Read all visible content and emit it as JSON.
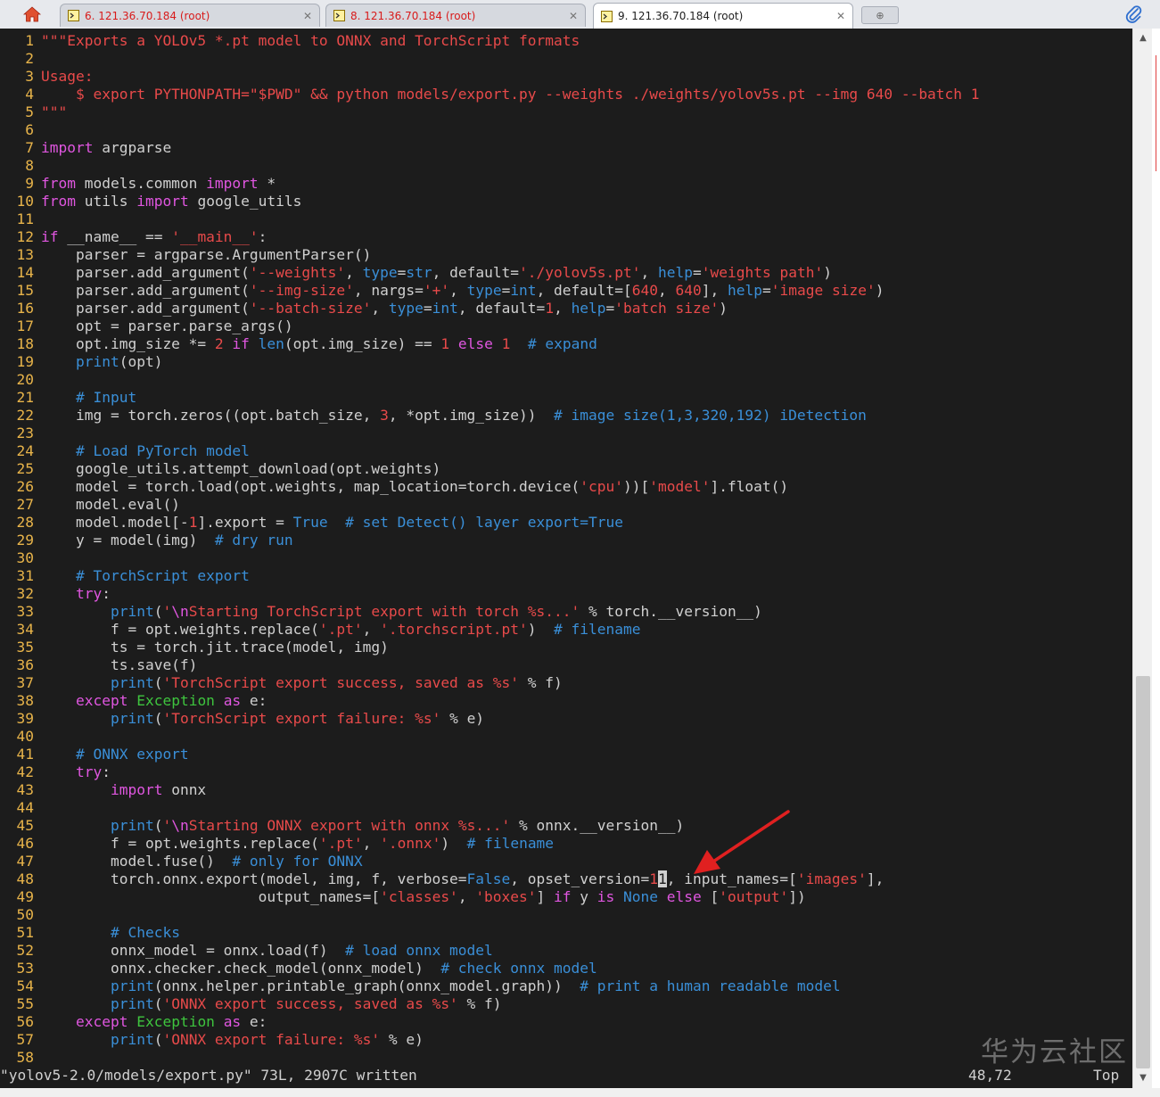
{
  "tabs": [
    {
      "title": "6. 121.36.70.184 (root)",
      "active": false
    },
    {
      "title": "8. 121.36.70.184 (root)",
      "active": false
    },
    {
      "title": "9. 121.36.70.184 (root)",
      "active": true
    }
  ],
  "icons": {
    "home": "home-icon",
    "terminal": "terminal-icon",
    "close": "close-icon",
    "new_tab": "new-tab-icon",
    "attachment": "paperclip-icon"
  },
  "colors": {
    "background": "#1c1c1c",
    "line_number": "#e8b44a",
    "string": "#e84a4a",
    "keyword": "#e056e0",
    "comment": "#3a8fd8",
    "class": "#3ec43e",
    "annotation_arrow": "#e02020"
  },
  "lines": [
    [
      [
        "s",
        "\"\"\"Exports a YOLOv5 *.pt model to ONNX and TorchScript formats"
      ]
    ],
    [],
    [
      [
        "s",
        "Usage:"
      ]
    ],
    [
      [
        "s",
        "    $ export PYTHONPATH=\"$PWD\" && python models/export.py --weights ./weights/yolov5s.pt --img 640 --batch 1"
      ]
    ],
    [
      [
        "s",
        "\"\"\""
      ]
    ],
    [],
    [
      [
        "k",
        "import"
      ],
      [
        "t",
        " argparse"
      ]
    ],
    [],
    [
      [
        "k",
        "from"
      ],
      [
        "t",
        " models.common "
      ],
      [
        "k",
        "import"
      ],
      [
        "t",
        " *"
      ]
    ],
    [
      [
        "k",
        "from"
      ],
      [
        "t",
        " utils "
      ],
      [
        "k",
        "import"
      ],
      [
        "t",
        " google_utils"
      ]
    ],
    [],
    [
      [
        "k",
        "if"
      ],
      [
        "t",
        " __name__ == "
      ],
      [
        "s",
        "'__main__'"
      ],
      [
        "t",
        ":"
      ]
    ],
    [
      [
        "t",
        "    parser = argparse.ArgumentParser()"
      ]
    ],
    [
      [
        "t",
        "    parser.add_argument("
      ],
      [
        "s",
        "'--weights'"
      ],
      [
        "t",
        ", "
      ],
      [
        "b",
        "type"
      ],
      [
        "t",
        "="
      ],
      [
        "b",
        "str"
      ],
      [
        "t",
        ", default="
      ],
      [
        "s",
        "'./yolov5s.pt'"
      ],
      [
        "t",
        ", "
      ],
      [
        "b",
        "help"
      ],
      [
        "t",
        "="
      ],
      [
        "s",
        "'weights path'"
      ],
      [
        "t",
        ")"
      ]
    ],
    [
      [
        "t",
        "    parser.add_argument("
      ],
      [
        "s",
        "'--img-size'"
      ],
      [
        "t",
        ", nargs="
      ],
      [
        "s",
        "'+'"
      ],
      [
        "t",
        ", "
      ],
      [
        "b",
        "type"
      ],
      [
        "t",
        "="
      ],
      [
        "b",
        "int"
      ],
      [
        "t",
        ", default=["
      ],
      [
        "n",
        "640"
      ],
      [
        "t",
        ", "
      ],
      [
        "n",
        "640"
      ],
      [
        "t",
        "], "
      ],
      [
        "b",
        "help"
      ],
      [
        "t",
        "="
      ],
      [
        "s",
        "'image size'"
      ],
      [
        "t",
        ")"
      ]
    ],
    [
      [
        "t",
        "    parser.add_argument("
      ],
      [
        "s",
        "'--batch-size'"
      ],
      [
        "t",
        ", "
      ],
      [
        "b",
        "type"
      ],
      [
        "t",
        "="
      ],
      [
        "b",
        "int"
      ],
      [
        "t",
        ", default="
      ],
      [
        "n",
        "1"
      ],
      [
        "t",
        ", "
      ],
      [
        "b",
        "help"
      ],
      [
        "t",
        "="
      ],
      [
        "s",
        "'batch size'"
      ],
      [
        "t",
        ")"
      ]
    ],
    [
      [
        "t",
        "    opt = parser.parse_args()"
      ]
    ],
    [
      [
        "t",
        "    opt.img_size *= "
      ],
      [
        "n",
        "2"
      ],
      [
        "t",
        " "
      ],
      [
        "k",
        "if"
      ],
      [
        "t",
        " "
      ],
      [
        "b",
        "len"
      ],
      [
        "t",
        "(opt.img_size) == "
      ],
      [
        "n",
        "1"
      ],
      [
        "t",
        " "
      ],
      [
        "k",
        "else"
      ],
      [
        "t",
        " "
      ],
      [
        "n",
        "1"
      ],
      [
        "t",
        "  "
      ],
      [
        "c",
        "# expand"
      ]
    ],
    [
      [
        "t",
        "    "
      ],
      [
        "b",
        "print"
      ],
      [
        "t",
        "(opt)"
      ]
    ],
    [],
    [
      [
        "t",
        "    "
      ],
      [
        "c",
        "# Input"
      ]
    ],
    [
      [
        "t",
        "    img = torch.zeros((opt.batch_size, "
      ],
      [
        "n",
        "3"
      ],
      [
        "t",
        ", *opt.img_size))  "
      ],
      [
        "c",
        "# image size(1,3,320,192) iDetection"
      ]
    ],
    [],
    [
      [
        "t",
        "    "
      ],
      [
        "c",
        "# Load PyTorch model"
      ]
    ],
    [
      [
        "t",
        "    google_utils.attempt_download(opt.weights)"
      ]
    ],
    [
      [
        "t",
        "    model = torch.load(opt.weights, map_location=torch.device("
      ],
      [
        "s",
        "'cpu'"
      ],
      [
        "t",
        "))["
      ],
      [
        "s",
        "'model'"
      ],
      [
        "t",
        "].float()"
      ]
    ],
    [
      [
        "t",
        "    model.eval()"
      ]
    ],
    [
      [
        "t",
        "    model.model[-"
      ],
      [
        "n",
        "1"
      ],
      [
        "t",
        "].export = "
      ],
      [
        "b",
        "True"
      ],
      [
        "t",
        "  "
      ],
      [
        "c",
        "# set Detect() layer export=True"
      ]
    ],
    [
      [
        "t",
        "    y = model(img)  "
      ],
      [
        "c",
        "# dry run"
      ]
    ],
    [],
    [
      [
        "t",
        "    "
      ],
      [
        "c",
        "# TorchScript export"
      ]
    ],
    [
      [
        "t",
        "    "
      ],
      [
        "k",
        "try"
      ],
      [
        "t",
        ":"
      ]
    ],
    [
      [
        "t",
        "        "
      ],
      [
        "b",
        "print"
      ],
      [
        "t",
        "("
      ],
      [
        "s",
        "'"
      ],
      [
        "k",
        "\\n"
      ],
      [
        "s",
        "Starting TorchScript export with torch %s...'"
      ],
      [
        "t",
        " % torch.__version__)"
      ]
    ],
    [
      [
        "t",
        "        f = opt.weights.replace("
      ],
      [
        "s",
        "'.pt'"
      ],
      [
        "t",
        ", "
      ],
      [
        "s",
        "'.torchscript.pt'"
      ],
      [
        "t",
        ")  "
      ],
      [
        "c",
        "# filename"
      ]
    ],
    [
      [
        "t",
        "        ts = torch.jit.trace(model, img)"
      ]
    ],
    [
      [
        "t",
        "        ts.save(f)"
      ]
    ],
    [
      [
        "t",
        "        "
      ],
      [
        "b",
        "print"
      ],
      [
        "t",
        "("
      ],
      [
        "s",
        "'TorchScript export success, saved as %s'"
      ],
      [
        "t",
        " % f)"
      ]
    ],
    [
      [
        "t",
        "    "
      ],
      [
        "k",
        "except"
      ],
      [
        "t",
        " "
      ],
      [
        "g",
        "Exception"
      ],
      [
        "t",
        " "
      ],
      [
        "k",
        "as"
      ],
      [
        "t",
        " e:"
      ]
    ],
    [
      [
        "t",
        "        "
      ],
      [
        "b",
        "print"
      ],
      [
        "t",
        "("
      ],
      [
        "s",
        "'TorchScript export failure: %s'"
      ],
      [
        "t",
        " % e)"
      ]
    ],
    [],
    [
      [
        "t",
        "    "
      ],
      [
        "c",
        "# ONNX export"
      ]
    ],
    [
      [
        "t",
        "    "
      ],
      [
        "k",
        "try"
      ],
      [
        "t",
        ":"
      ]
    ],
    [
      [
        "t",
        "        "
      ],
      [
        "k",
        "import"
      ],
      [
        "t",
        " onnx"
      ]
    ],
    [],
    [
      [
        "t",
        "        "
      ],
      [
        "b",
        "print"
      ],
      [
        "t",
        "("
      ],
      [
        "s",
        "'"
      ],
      [
        "k",
        "\\n"
      ],
      [
        "s",
        "Starting ONNX export with onnx %s...'"
      ],
      [
        "t",
        " % onnx.__version__)"
      ]
    ],
    [
      [
        "t",
        "        f = opt.weights.replace("
      ],
      [
        "s",
        "'.pt'"
      ],
      [
        "t",
        ", "
      ],
      [
        "s",
        "'.onnx'"
      ],
      [
        "t",
        ")  "
      ],
      [
        "c",
        "# filename"
      ]
    ],
    [
      [
        "t",
        "        model.fuse()  "
      ],
      [
        "c",
        "# only for ONNX"
      ]
    ],
    [
      [
        "t",
        "        torch.onnx.export(model, img, f, verbose="
      ],
      [
        "b",
        "False"
      ],
      [
        "t",
        ", opset_version="
      ],
      [
        "n",
        "1"
      ],
      [
        "u",
        "1"
      ],
      [
        "t",
        ", input_names=["
      ],
      [
        "s",
        "'images'"
      ],
      [
        "t",
        "],"
      ]
    ],
    [
      [
        "t",
        "                         output_names=["
      ],
      [
        "s",
        "'classes'"
      ],
      [
        "t",
        ", "
      ],
      [
        "s",
        "'boxes'"
      ],
      [
        "t",
        "] "
      ],
      [
        "k",
        "if"
      ],
      [
        "t",
        " y "
      ],
      [
        "k",
        "is"
      ],
      [
        "t",
        " "
      ],
      [
        "b",
        "None"
      ],
      [
        "t",
        " "
      ],
      [
        "k",
        "else"
      ],
      [
        "t",
        " ["
      ],
      [
        "s",
        "'output'"
      ],
      [
        "t",
        "])"
      ]
    ],
    [],
    [
      [
        "t",
        "        "
      ],
      [
        "c",
        "# Checks"
      ]
    ],
    [
      [
        "t",
        "        onnx_model = onnx.load(f)  "
      ],
      [
        "c",
        "# load onnx model"
      ]
    ],
    [
      [
        "t",
        "        onnx.checker.check_model(onnx_model)  "
      ],
      [
        "c",
        "# check onnx model"
      ]
    ],
    [
      [
        "t",
        "        "
      ],
      [
        "b",
        "print"
      ],
      [
        "t",
        "(onnx.helper.printable_graph(onnx_model.graph))  "
      ],
      [
        "c",
        "# print a human readable model"
      ]
    ],
    [
      [
        "t",
        "        "
      ],
      [
        "b",
        "print"
      ],
      [
        "t",
        "("
      ],
      [
        "s",
        "'ONNX export success, saved as %s'"
      ],
      [
        "t",
        " % f)"
      ]
    ],
    [
      [
        "t",
        "    "
      ],
      [
        "k",
        "except"
      ],
      [
        "t",
        " "
      ],
      [
        "g",
        "Exception"
      ],
      [
        "t",
        " "
      ],
      [
        "k",
        "as"
      ],
      [
        "t",
        " e:"
      ]
    ],
    [
      [
        "t",
        "        "
      ],
      [
        "b",
        "print"
      ],
      [
        "t",
        "("
      ],
      [
        "s",
        "'ONNX export failure: %s'"
      ],
      [
        "t",
        " % e)"
      ]
    ],
    []
  ],
  "status": {
    "file": "\"yolov5-2.0/models/export.py\" 73L, 2907C written",
    "position": "48,72",
    "scroll": "Top"
  },
  "watermark": "华为云社区"
}
